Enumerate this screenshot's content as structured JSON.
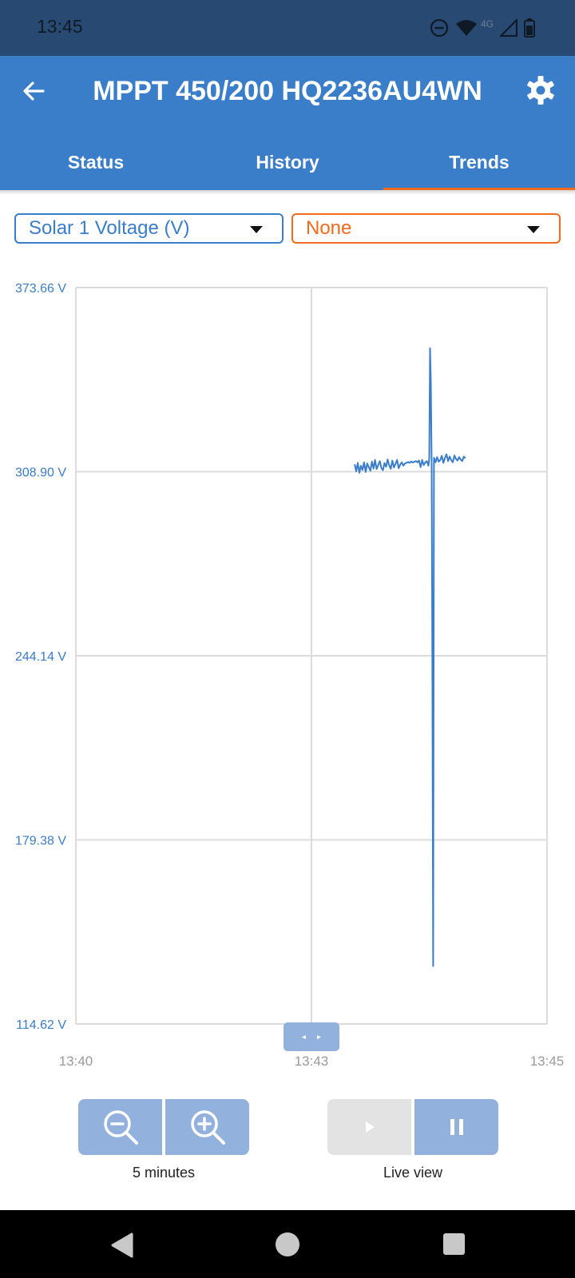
{
  "status_bar": {
    "time": "13:45",
    "network_label": "4G"
  },
  "app_bar": {
    "title": "MPPT 450/200 HQ2236AU4WN"
  },
  "tabs": [
    {
      "label": "Status",
      "active": false
    },
    {
      "label": "History",
      "active": false
    },
    {
      "label": "Trends",
      "active": true
    }
  ],
  "selectors": {
    "primary": {
      "value": "Solar 1 Voltage (V)",
      "color": "#3a7dc9"
    },
    "secondary": {
      "value": "None",
      "color": "#f26b1d"
    }
  },
  "chart_data": {
    "type": "line",
    "ylim": [
      114.62,
      373.66
    ],
    "y_ticks": [
      "373.66 V",
      "308.90 V",
      "244.14 V",
      "179.38 V",
      "114.62 V"
    ],
    "y_tick_values": [
      373.66,
      308.9,
      244.14,
      179.38,
      114.62
    ],
    "x_ticks": [
      "13:40",
      "13:43",
      "13:45"
    ],
    "x_tick_minutes": [
      0,
      3,
      6
    ],
    "xlim_minutes": [
      0,
      6
    ],
    "grid": true,
    "color": "#3a7dc9",
    "series": [
      {
        "x_minutes": [
          3.55,
          3.57,
          3.59,
          3.61,
          3.63,
          3.65,
          3.67,
          3.69,
          3.71,
          3.73,
          3.75,
          3.77,
          3.79,
          3.81,
          3.83,
          3.85,
          3.87,
          3.89,
          3.91,
          3.93,
          3.95,
          3.97,
          3.99,
          4.01,
          4.03,
          4.05,
          4.07,
          4.09,
          4.11,
          4.13,
          4.15,
          4.17,
          4.19,
          4.21,
          4.23,
          4.25,
          4.27,
          4.29,
          4.31,
          4.33,
          4.35,
          4.37,
          4.39,
          4.41,
          4.43,
          4.45,
          4.47,
          4.49,
          4.5,
          4.51,
          4.52,
          4.53,
          4.54,
          4.55,
          4.56,
          4.58,
          4.6,
          4.62,
          4.64,
          4.66,
          4.68,
          4.7,
          4.72,
          4.74,
          4.76,
          4.78,
          4.8,
          4.82,
          4.84,
          4.86,
          4.88,
          4.9,
          4.92,
          4.94,
          4.96
        ],
        "y": [
          311.5,
          309.0,
          312.0,
          308.5,
          311.0,
          309.5,
          312.2,
          308.8,
          311.8,
          310.5,
          309.2,
          312.4,
          310.0,
          313.0,
          309.8,
          311.2,
          312.6,
          310.2,
          309.4,
          311.9,
          310.6,
          313.2,
          311.0,
          309.9,
          312.8,
          310.4,
          311.6,
          313.0,
          310.1,
          311.4,
          312.2,
          311.0,
          311.8,
          312.0,
          312.3,
          312.0,
          312.5,
          312.1,
          312.4,
          312.6,
          312.2,
          312.8,
          310.5,
          313.0,
          311.2,
          312.2,
          312.6,
          311.0,
          313.5,
          352.3,
          340.0,
          311.0,
          240.0,
          135.0,
          313.8,
          312.2,
          314.0,
          312.4,
          313.0,
          314.5,
          312.0,
          313.8,
          315.0,
          312.6,
          314.2,
          313.0,
          312.2,
          314.6,
          313.4,
          312.8,
          314.0,
          313.2,
          312.6,
          314.2,
          313.6
        ]
      }
    ]
  }
}
